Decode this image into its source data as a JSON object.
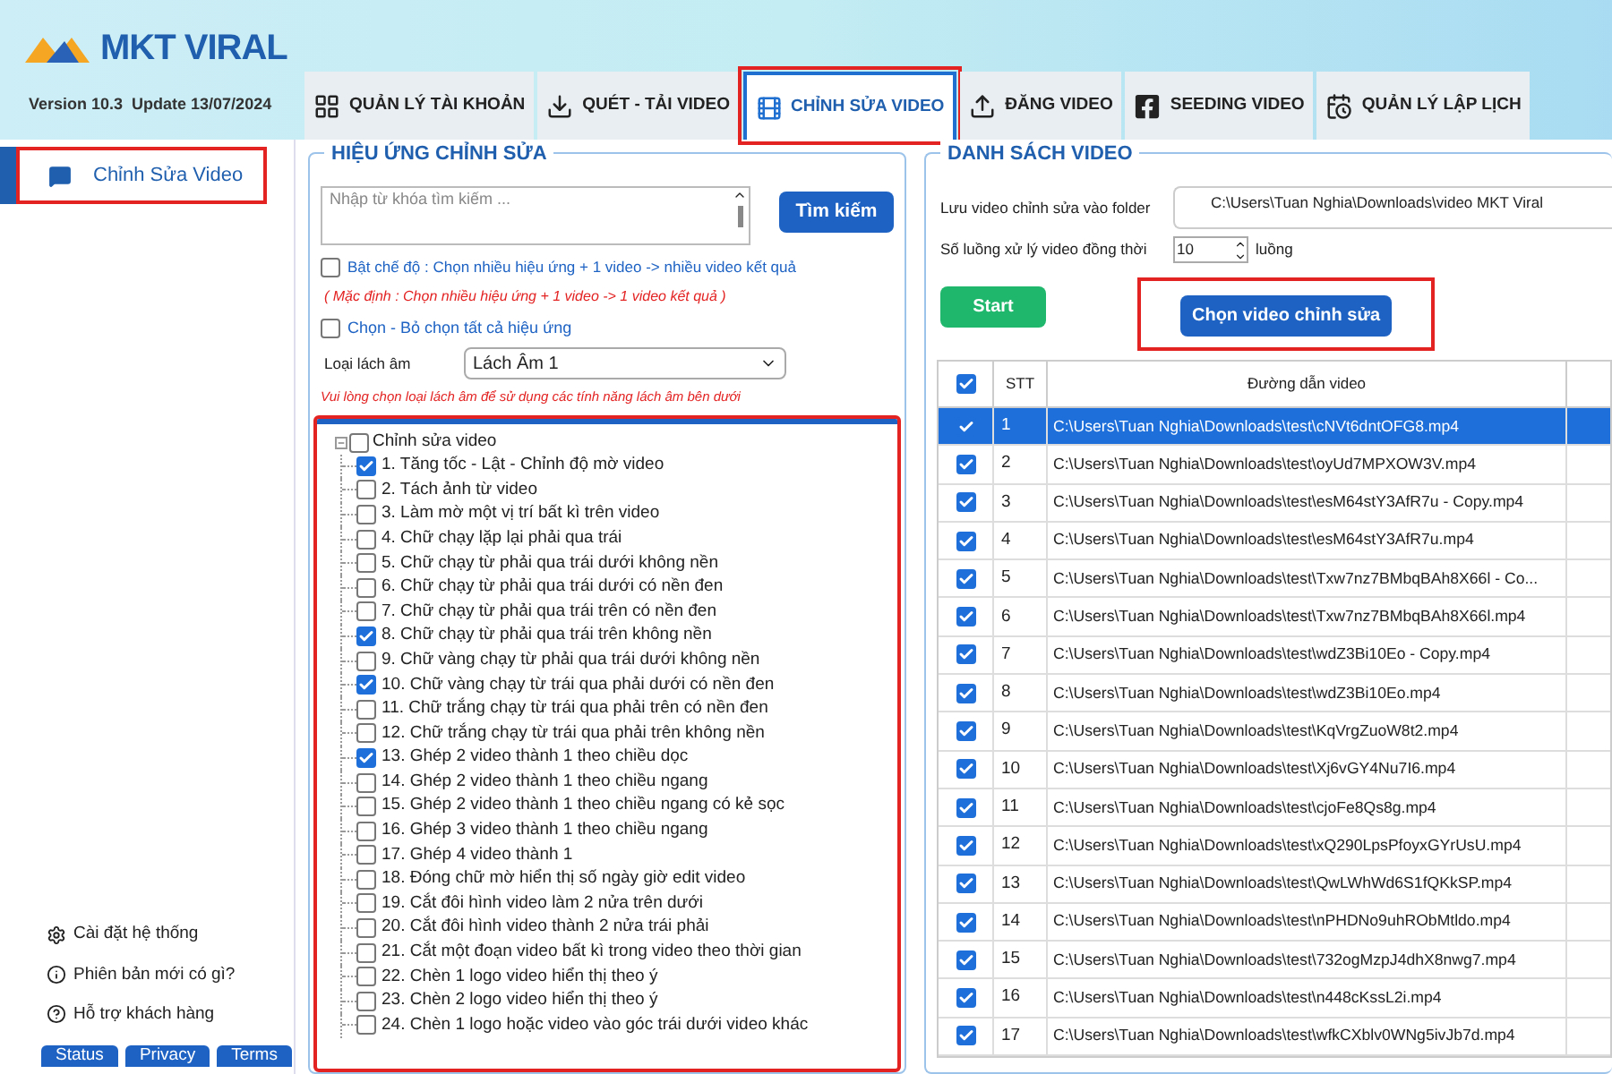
{
  "header": {
    "logo_text": "MKT VIRAL",
    "version": "Version 10.3  Update 13/07/2024"
  },
  "tabs": [
    {
      "label": "QUẢN LÝ TÀI KHOẢN",
      "kind": "grid",
      "selected": false
    },
    {
      "label": "QUÉT - TẢI VIDEO",
      "kind": "download",
      "selected": false
    },
    {
      "label": "CHỈNH SỬA VIDEO",
      "kind": "film",
      "selected": true
    },
    {
      "label": "ĐĂNG VIDEO",
      "kind": "upload",
      "selected": false
    },
    {
      "label": "SEEDING VIDEO",
      "kind": "facebook",
      "selected": false
    },
    {
      "label": "QUẢN LÝ LẬP LỊCH",
      "kind": "calendar",
      "selected": false
    }
  ],
  "sidebar": {
    "items": [
      {
        "label": "Chỉnh Sửa Video",
        "selected": true
      }
    ],
    "footer_links": [
      {
        "label": "Cài đặt hệ thống",
        "kind": "settings"
      },
      {
        "label": "Phiên bản mới có gì?",
        "kind": "info"
      },
      {
        "label": "Hỗ trợ khách hàng",
        "kind": "help"
      }
    ],
    "footer_buttons": [
      "Status",
      "Privacy",
      "Terms"
    ]
  },
  "effects_panel": {
    "title": "HIỆU ỨNG CHỈNH SỬA",
    "search_placeholder": "Nhập từ khóa tìm kiếm ...",
    "search_button": "Tìm kiếm",
    "multi_mode": {
      "label": "Bật chế độ : Chọn nhiều hiệu ứng + 1 video -> nhiều video kết quả",
      "checked": false
    },
    "note": "( Mặc định : Chọn nhiều hiệu ứng + 1 video -> 1 video kết quả )",
    "select_all": {
      "label": "Chọn - Bỏ chọn tất cả hiệu ứng",
      "checked": false
    },
    "voice_label": "Loại lách âm",
    "voice_value": "Lách Âm 1",
    "warning": "Vui lòng chọn loại lách âm để sử dụng các tính năng lách âm bên dưới",
    "tree": {
      "label": "Chỉnh sửa video",
      "checked": false,
      "expanded": true,
      "children": [
        {
          "label": "1. Tăng tốc - Lật - Chỉnh độ mờ video",
          "checked": true
        },
        {
          "label": "2. Tách ảnh từ video",
          "checked": false
        },
        {
          "label": "3. Làm mờ một vị trí bất kì trên video",
          "checked": false
        },
        {
          "label": "4. Chữ chạy lặp lại phải qua trái",
          "checked": false
        },
        {
          "label": "5. Chữ chạy từ phải qua trái dưới không nền",
          "checked": false
        },
        {
          "label": "6. Chữ chạy từ phải qua trái dưới có nền đen",
          "checked": false
        },
        {
          "label": "7. Chữ chạy từ phải qua trái trên có nền đen",
          "checked": false
        },
        {
          "label": "8. Chữ chạy từ phải qua trái trên không nền",
          "checked": true
        },
        {
          "label": "9. Chữ vàng chạy từ phải qua trái dưới không nền",
          "checked": false
        },
        {
          "label": "10. Chữ vàng chạy từ trái qua phải dưới có nền đen",
          "checked": true
        },
        {
          "label": "11. Chữ trắng chạy từ trái qua phải trên có nền đen",
          "checked": false
        },
        {
          "label": "12. Chữ trắng chạy từ trái qua phải trên không nền",
          "checked": false
        },
        {
          "label": "13. Ghép 2 video thành 1 theo chiều dọc",
          "checked": true
        },
        {
          "label": "14. Ghép 2 video thành 1 theo chiều ngang",
          "checked": false
        },
        {
          "label": "15. Ghép 2 video thành 1 theo chiều ngang có kẻ sọc",
          "checked": false
        },
        {
          "label": "16. Ghép 3 video thành 1 theo chiều ngang",
          "checked": false
        },
        {
          "label": "17. Ghép 4 video thành 1",
          "checked": false
        },
        {
          "label": "18. Đóng chữ mờ hiển thị số ngày giờ edit video",
          "checked": false
        },
        {
          "label": "19. Cắt đôi hình video làm 2 nửa trên dưới",
          "checked": false
        },
        {
          "label": "20. Cắt đôi hình video thành 2 nửa trái phải",
          "checked": false
        },
        {
          "label": "21. Cắt một đoạn video bất kì trong video theo thời gian",
          "checked": false
        },
        {
          "label": "22. Chèn 1 logo video hiển thị theo ý",
          "checked": false
        },
        {
          "label": "23. Chèn 2 logo video hiển thị theo ý",
          "checked": false
        },
        {
          "label": "24. Chèn 1 logo hoặc video vào góc trái dưới video khác",
          "checked": false
        }
      ]
    }
  },
  "video_panel": {
    "title": "DANH SÁCH VIDEO",
    "folder_label": "Lưu video chỉnh sửa vào folder",
    "folder_value": "C:\\Users\\Tuan Nghia\\Downloads\\video MKT Viral",
    "threads_label": "Số luồng xử lý video đồng thời",
    "threads_value": "10",
    "threads_unit": "luồng",
    "start_button": "Start",
    "choose_button": "Chọn video chỉnh sửa",
    "table": {
      "header_checked": true,
      "columns": [
        "STT",
        "Đường dẫn video"
      ],
      "rows": [
        {
          "checked": true,
          "selected": true,
          "stt": "1",
          "path": "C:\\Users\\Tuan Nghia\\Downloads\\test\\cNVt6dntOFG8.mp4"
        },
        {
          "checked": true,
          "selected": false,
          "stt": "2",
          "path": "C:\\Users\\Tuan Nghia\\Downloads\\test\\oyUd7MPXOW3V.mp4"
        },
        {
          "checked": true,
          "selected": false,
          "stt": "3",
          "path": "C:\\Users\\Tuan Nghia\\Downloads\\test\\esM64stY3AfR7u - Copy.mp4"
        },
        {
          "checked": true,
          "selected": false,
          "stt": "4",
          "path": "C:\\Users\\Tuan Nghia\\Downloads\\test\\esM64stY3AfR7u.mp4"
        },
        {
          "checked": true,
          "selected": false,
          "stt": "5",
          "path": "C:\\Users\\Tuan Nghia\\Downloads\\test\\Txw7nz7BMbqBAh8X66l - Co..."
        },
        {
          "checked": true,
          "selected": false,
          "stt": "6",
          "path": "C:\\Users\\Tuan Nghia\\Downloads\\test\\Txw7nz7BMbqBAh8X66l.mp4"
        },
        {
          "checked": true,
          "selected": false,
          "stt": "7",
          "path": "C:\\Users\\Tuan Nghia\\Downloads\\test\\wdZ3Bi10Eo - Copy.mp4"
        },
        {
          "checked": true,
          "selected": false,
          "stt": "8",
          "path": "C:\\Users\\Tuan Nghia\\Downloads\\test\\wdZ3Bi10Eo.mp4"
        },
        {
          "checked": true,
          "selected": false,
          "stt": "9",
          "path": "C:\\Users\\Tuan Nghia\\Downloads\\test\\KqVrgZuoW8t2.mp4"
        },
        {
          "checked": true,
          "selected": false,
          "stt": "10",
          "path": "C:\\Users\\Tuan Nghia\\Downloads\\test\\Xj6vGY4Nu7I6.mp4"
        },
        {
          "checked": true,
          "selected": false,
          "stt": "11",
          "path": "C:\\Users\\Tuan Nghia\\Downloads\\test\\cjoFe8Qs8g.mp4"
        },
        {
          "checked": true,
          "selected": false,
          "stt": "12",
          "path": "C:\\Users\\Tuan Nghia\\Downloads\\test\\xQ290LpsPfoyxGYrUsU.mp4"
        },
        {
          "checked": true,
          "selected": false,
          "stt": "13",
          "path": "C:\\Users\\Tuan Nghia\\Downloads\\test\\QwLWhWd6S1fQKkSP.mp4"
        },
        {
          "checked": true,
          "selected": false,
          "stt": "14",
          "path": "C:\\Users\\Tuan Nghia\\Downloads\\test\\nPHDNo9uhRObMtldo.mp4"
        },
        {
          "checked": true,
          "selected": false,
          "stt": "15",
          "path": "C:\\Users\\Tuan Nghia\\Downloads\\test\\732ogMzpJ4dhX8nwg7.mp4"
        },
        {
          "checked": true,
          "selected": false,
          "stt": "16",
          "path": "C:\\Users\\Tuan Nghia\\Downloads\\test\\n448cKssL2i.mp4"
        },
        {
          "checked": true,
          "selected": false,
          "stt": "17",
          "path": "C:\\Users\\Tuan Nghia\\Downloads\\test\\wfkCXblv0WNg5ivJb7d.mp4"
        }
      ]
    }
  }
}
